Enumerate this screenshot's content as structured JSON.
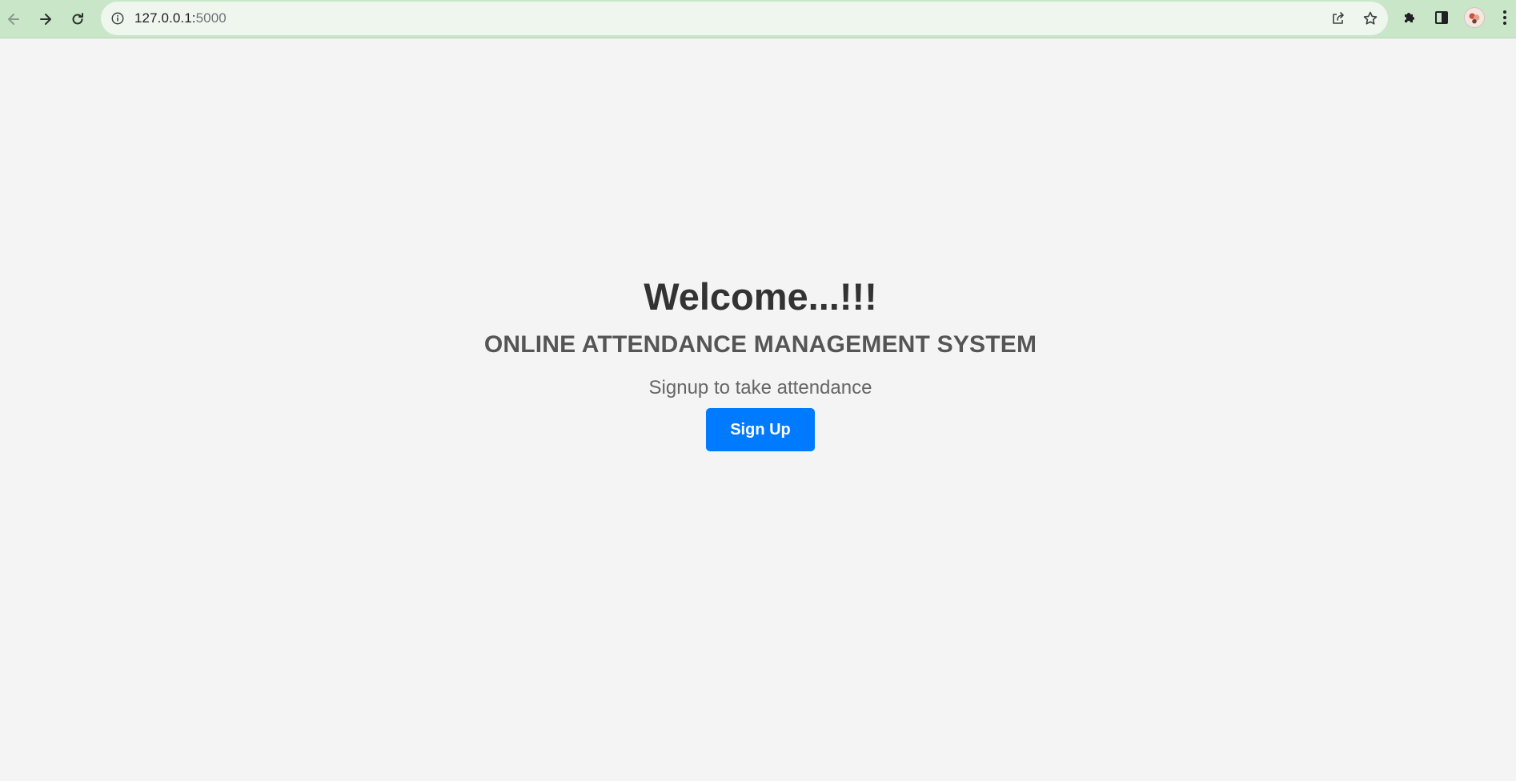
{
  "browser": {
    "url_host": "127.0.0.1:",
    "url_port": "5000",
    "icons": {
      "back": "arrow-left-icon",
      "forward": "arrow-right-icon",
      "reload": "reload-icon",
      "site_info": "info-icon",
      "share": "share-icon",
      "bookmark": "star-icon",
      "extensions": "puzzle-icon",
      "side_panel": "side-panel-icon",
      "profile": "avatar",
      "menu": "more-vert-icon"
    },
    "colors": {
      "toolbar_bg": "#c9e6c9",
      "omnibox_bg": "#eef6ee"
    }
  },
  "page": {
    "heading": "Welcome...!!!",
    "subtitle": "ONLINE ATTENDANCE MANAGEMENT SYSTEM",
    "tagline": "Signup to take attendance",
    "signup_button": "Sign Up",
    "colors": {
      "background": "#f4f4f4",
      "button": "#007bff",
      "heading": "#333333"
    }
  }
}
